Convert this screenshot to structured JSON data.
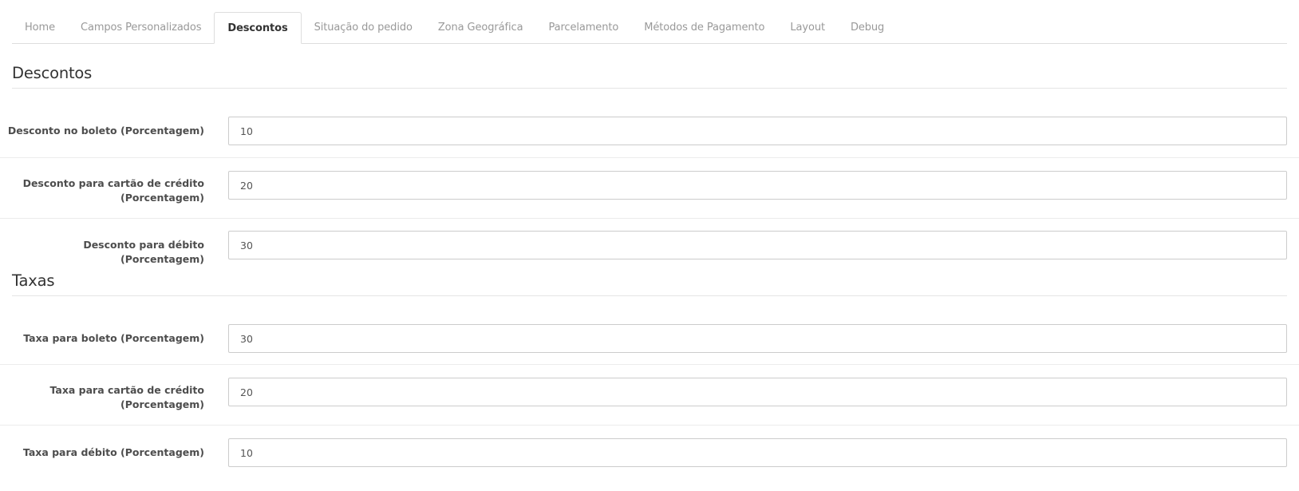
{
  "tabs": [
    {
      "label": "Home",
      "active": false
    },
    {
      "label": "Campos Personalizados",
      "active": false
    },
    {
      "label": "Descontos",
      "active": true
    },
    {
      "label": "Situação do pedido",
      "active": false
    },
    {
      "label": "Zona Geográfica",
      "active": false
    },
    {
      "label": "Parcelamento",
      "active": false
    },
    {
      "label": "Métodos de Pagamento",
      "active": false
    },
    {
      "label": "Layout",
      "active": false
    },
    {
      "label": "Debug",
      "active": false
    }
  ],
  "descontos": {
    "title": "Descontos",
    "fields": [
      {
        "label": "Desconto no boleto (Porcentagem)",
        "value": "10"
      },
      {
        "label_line1": "Desconto para cartão de crédito",
        "label_line2": "(Porcentagem)",
        "value": "20"
      },
      {
        "label": "Desconto para débito (Porcentagem)",
        "value": "30"
      }
    ]
  },
  "taxas": {
    "title": "Taxas",
    "fields": [
      {
        "label": "Taxa para boleto (Porcentagem)",
        "value": "30"
      },
      {
        "label_line1": "Taxa para cartão de crédito",
        "label_line2": "(Porcentagem)",
        "value": "20"
      },
      {
        "label": "Taxa para débito (Porcentagem)",
        "value": "10"
      }
    ]
  }
}
